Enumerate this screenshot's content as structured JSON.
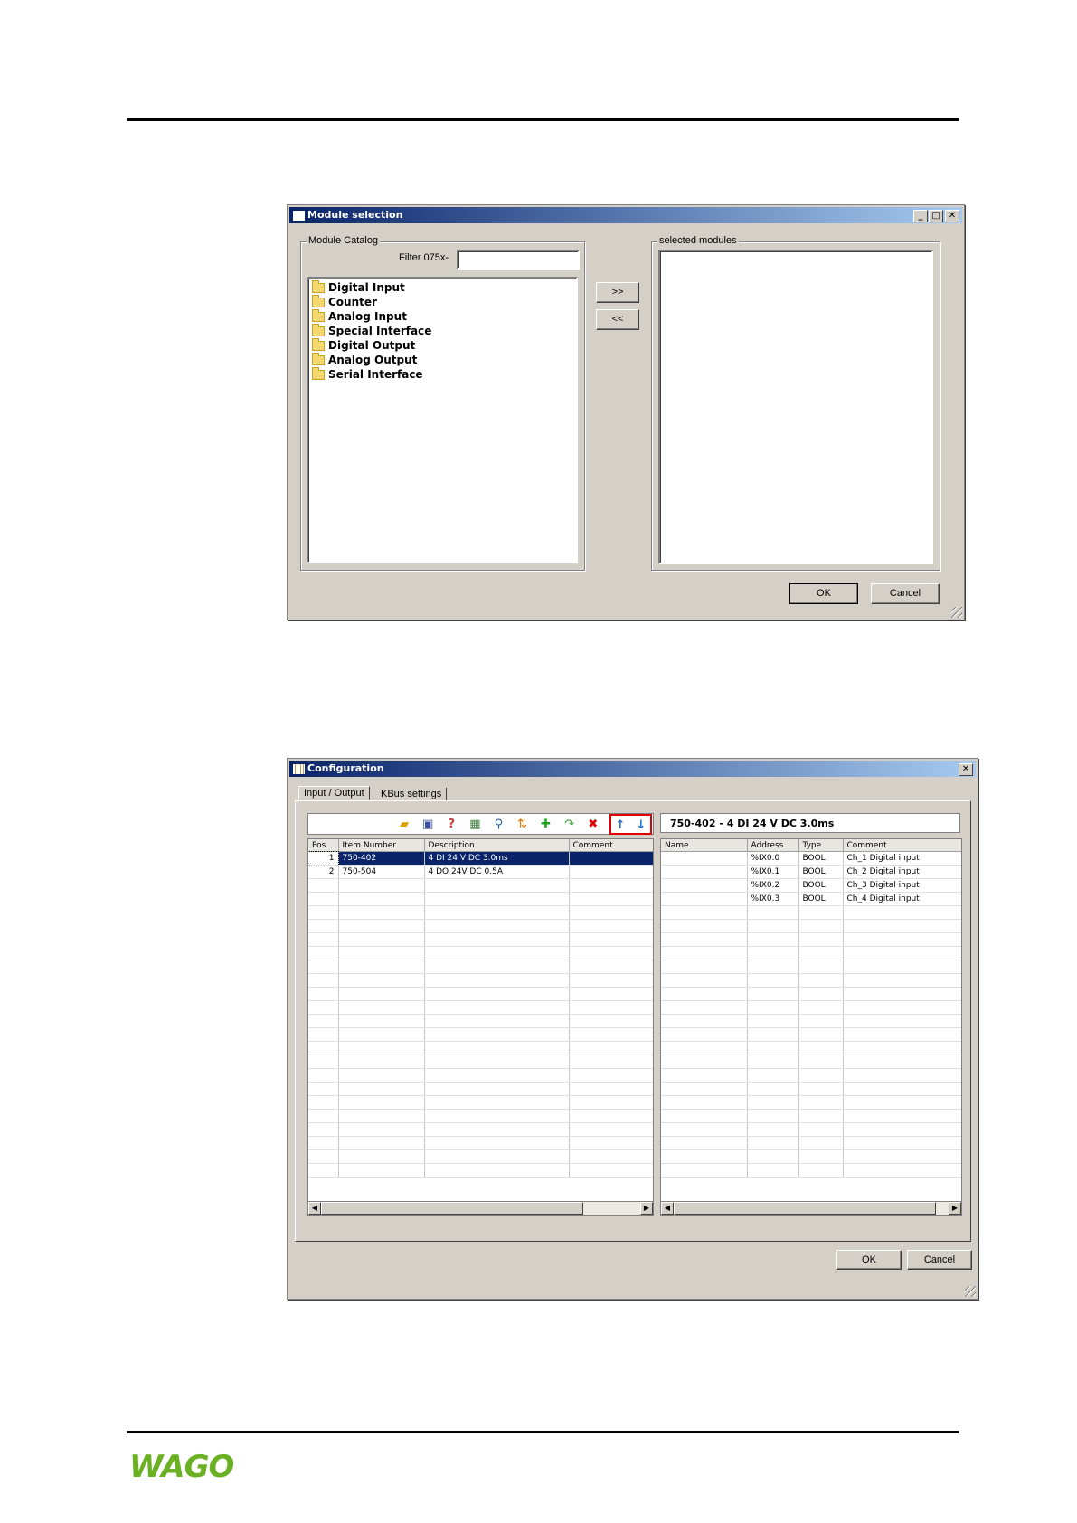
{
  "module_selection": {
    "title": "Module selection",
    "catalog_label": "Module Catalog",
    "filter_label": "Filter 075x-",
    "filter_value": "",
    "catalog_items": [
      "Digital Input",
      "Counter",
      "Analog Input",
      "Special Interface",
      "Digital Output",
      "Analog Output",
      "Serial Interface"
    ],
    "add_label": ">>",
    "remove_label": "<<",
    "selected_label": "selected modules",
    "ok_label": "OK",
    "cancel_label": "Cancel"
  },
  "configuration": {
    "title": "Configuration",
    "tabs": [
      "Input / Output",
      "KBus settings"
    ],
    "module_header": "750-402 - 4 DI 24 V DC 3.0ms",
    "left_columns": [
      "Pos.",
      "Item Number",
      "Description",
      "Comment"
    ],
    "left_rows": [
      {
        "pos": "1",
        "item": "750-402",
        "desc": "4 DI 24 V DC 3.0ms",
        "comment": ""
      },
      {
        "pos": "2",
        "item": "750-504",
        "desc": "4 DO 24V DC 0.5A",
        "comment": ""
      }
    ],
    "right_columns": [
      "Name",
      "Address",
      "Type",
      "Comment"
    ],
    "right_rows": [
      {
        "name": "",
        "address": "%IX0.0",
        "type": "BOOL",
        "comment": "Ch_1 Digital input"
      },
      {
        "name": "",
        "address": "%IX0.1",
        "type": "BOOL",
        "comment": "Ch_2 Digital input"
      },
      {
        "name": "",
        "address": "%IX0.2",
        "type": "BOOL",
        "comment": "Ch_3 Digital input"
      },
      {
        "name": "",
        "address": "%IX0.3",
        "type": "BOOL",
        "comment": "Ch_4 Digital input"
      }
    ],
    "ok_label": "OK",
    "cancel_label": "Cancel"
  },
  "footer": {
    "logo_text": "WAGO",
    "brand_color": "#6ab023"
  },
  "highlight_color": "#e00000"
}
